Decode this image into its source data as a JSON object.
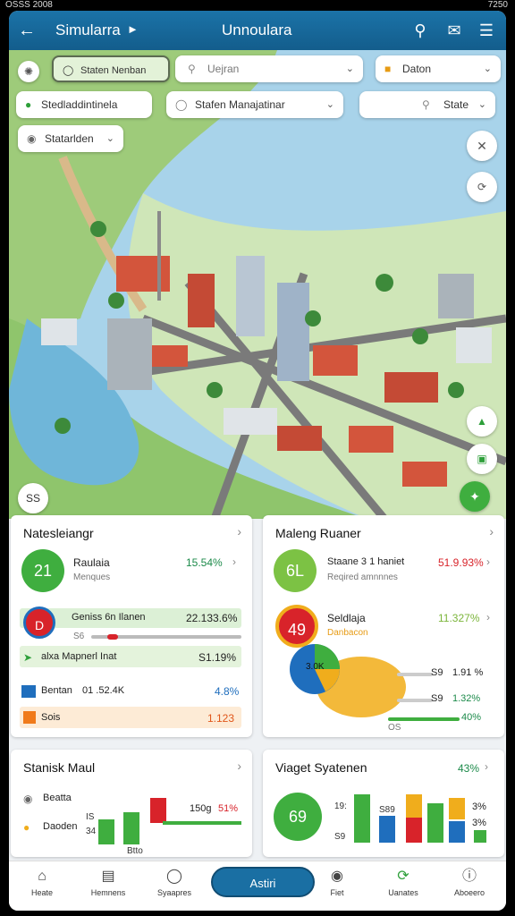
{
  "status_bar": {
    "left": "OSSS 2008",
    "right": "7250"
  },
  "appbar": {
    "title": "Simularra",
    "center_title": "Unnoulara"
  },
  "filters": {
    "chip1": "Staten Nenban",
    "search_placeholder": "Uejran",
    "chip3": "Daton",
    "chip4": "Stedladdintinela",
    "chip5": "Stafen Manajatinar",
    "chip6": "State",
    "chip7": "Statarlden",
    "map_corner_label": "SS"
  },
  "card1": {
    "title": "Natesleiangr",
    "circle_value": "21",
    "name": "Raulaia",
    "sub": "Menques",
    "pct": "15.54%",
    "r1_label": "Geniss 6n Ilanen",
    "r1_value": "22.133.6%",
    "r1_circle": "D",
    "r1_sub": "S6",
    "r2_label": "alxa   Mapnerl Inat",
    "r2_value": "S1.19%",
    "r3_label": "Bentan",
    "r3_mid": "01 .52.4K",
    "r3_value": "4.8%",
    "r4_label": "Sois",
    "r4_value": "1.123"
  },
  "card2": {
    "title": "Maleng Ruaner",
    "circle1": "6L",
    "name1": "Staane 3 1 haniet",
    "sub1": "Reqired amnnnes",
    "pct1": "51.9.93%",
    "circle2": "49",
    "name2": "Seldlaja",
    "sub2": "Danbacon",
    "pct2": "11.327%",
    "pie_label": "3.0K",
    "row1_label": "S9",
    "row1_value": "1.91 %",
    "row2_label": "S9",
    "row2_value": "1.32%",
    "row3_label": "OS",
    "row3_value": "40%"
  },
  "card3": {
    "title": "Stanisk Maul",
    "item1": "Beatta",
    "item2": "Daoden",
    "axis_top": "IS",
    "axis_bottom": "34",
    "chart_value": "150g",
    "chart_pct": "51%",
    "bottom_label": "Btto"
  },
  "card4": {
    "title": "Viaget Syatenen",
    "pct": "43%",
    "circle_value": "69",
    "axis_top": "19:",
    "axis_bottom": "S9",
    "inner_label": "S89",
    "right_top": "3%",
    "right_bottom": "3%"
  },
  "bottom_nav": {
    "items": [
      "Heate",
      "Hemnens",
      "Syaapres",
      "Fiet",
      "Uanates",
      "Aboeero"
    ],
    "primary": "Astiri"
  },
  "colors": {
    "primary": "#1a6fa3",
    "green": "#3fae3f",
    "red": "#d8232a",
    "orange": "#f0ad1c",
    "blue": "#1f6ebd"
  }
}
